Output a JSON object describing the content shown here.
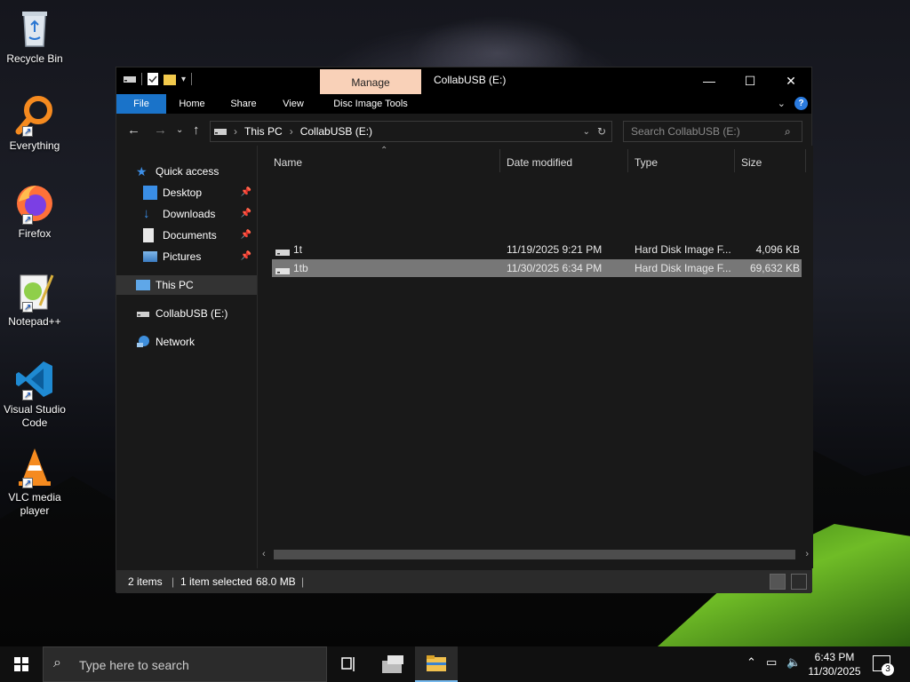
{
  "desktop": {
    "icons": [
      {
        "label": "Recycle Bin",
        "icon": "recycle-bin-icon"
      },
      {
        "label": "Everything",
        "icon": "everything-search-icon"
      },
      {
        "label": "Firefox",
        "icon": "firefox-icon"
      },
      {
        "label": "Notepad++",
        "icon": "notepad-plus-plus-icon"
      },
      {
        "label": "Visual Studio Code",
        "icon": "vscode-icon"
      },
      {
        "label": "VLC media player",
        "icon": "vlc-icon"
      }
    ]
  },
  "window": {
    "title": "CollabUSB (E:)",
    "context_tab": "Manage",
    "ribbon_tabs": [
      "File",
      "Home",
      "Share",
      "View",
      "Disc Image Tools"
    ],
    "nav": {
      "breadcrumb": [
        "This PC",
        "CollabUSB (E:)"
      ],
      "search_placeholder": "Search CollabUSB (E:)"
    },
    "sidebar": {
      "quick_access": "Quick access",
      "quick_items": [
        "Desktop",
        "Downloads",
        "Documents",
        "Pictures"
      ],
      "this_pc": "This PC",
      "drive": "CollabUSB (E:)",
      "network": "Network"
    },
    "columns": [
      "Name",
      "Date modified",
      "Type",
      "Size"
    ],
    "files": [
      {
        "name": "1t",
        "date": "11/19/2025 9:21 PM",
        "type": "Hard Disk Image F...",
        "size": "4,096 KB",
        "selected": false
      },
      {
        "name": "1tb",
        "date": "11/30/2025 6:34 PM",
        "type": "Hard Disk Image F...",
        "size": "69,632 KB",
        "selected": true
      }
    ],
    "status": {
      "items": "2 items",
      "selected": "1 item selected",
      "size": "68.0 MB"
    }
  },
  "taskbar": {
    "search_placeholder": "Type here to search",
    "time": "6:43 PM",
    "date": "11/30/2025",
    "notification_count": "3"
  }
}
